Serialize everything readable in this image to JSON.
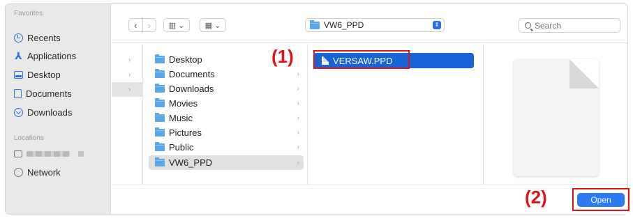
{
  "sidebar": {
    "favorites_heading": "Favorites",
    "favorites": [
      {
        "label": "Recents",
        "icon": "clock-icon"
      },
      {
        "label": "Applications",
        "icon": "applications-icon"
      },
      {
        "label": "Desktop",
        "icon": "desktop-icon"
      },
      {
        "label": "Documents",
        "icon": "document-icon"
      },
      {
        "label": "Downloads",
        "icon": "download-icon"
      }
    ],
    "locations_heading": "Locations",
    "locations": [
      {
        "label": "",
        "icon": "disk-icon",
        "redacted": true
      },
      {
        "label": "Network",
        "icon": "globe-icon"
      }
    ]
  },
  "toolbar": {
    "back_glyph": "‹",
    "forward_glyph": "›",
    "view_glyph": "▥ ⌄",
    "group_glyph": "▦ ⌄",
    "path_label": "VW6_PPD",
    "search_placeholder": "Search"
  },
  "col1": {
    "chevrons": [
      "›",
      "›",
      "›"
    ]
  },
  "col2": {
    "items": [
      {
        "label": "Desktop",
        "chevron": ""
      },
      {
        "label": "Documents",
        "chevron": "›"
      },
      {
        "label": "Downloads",
        "chevron": "›"
      },
      {
        "label": "Movies",
        "chevron": "›"
      },
      {
        "label": "Music",
        "chevron": "›"
      },
      {
        "label": "Pictures",
        "chevron": "›"
      },
      {
        "label": "Public",
        "chevron": "›"
      },
      {
        "label": "VW6_PPD",
        "chevron": "›",
        "selected": true
      }
    ]
  },
  "col3": {
    "file_label": "VERSAW.PPD"
  },
  "callouts": {
    "step1": "(1)",
    "step2": "(2)"
  },
  "actions": {
    "open_label": "Open"
  },
  "colors": {
    "accent": "#2b7bf5",
    "selection": "#1664d6",
    "callout_red": "#e0141a",
    "folder": "#5aa7e8"
  }
}
